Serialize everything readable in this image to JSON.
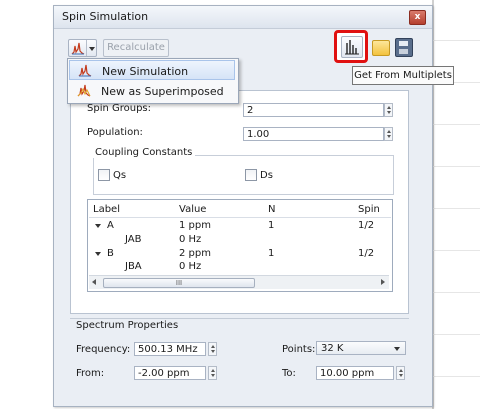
{
  "window": {
    "title": "Spin Simulation",
    "close_symbol": "x"
  },
  "toolbar": {
    "recalculate_label": "Recalculate"
  },
  "menu": {
    "items": [
      {
        "label": "New Simulation"
      },
      {
        "label": "New as Superimposed"
      }
    ]
  },
  "tooltip": {
    "text": "Get From Multiplets"
  },
  "form": {
    "spin_groups_label": "Spin Groups:",
    "spin_groups_value": "2",
    "population_label": "Population:",
    "population_value": "1.00"
  },
  "coupling": {
    "title": "Coupling Constants",
    "qs_label": "Qs",
    "ds_label": "Ds"
  },
  "table": {
    "headers": [
      "Label",
      "Value",
      "N",
      "Spin"
    ],
    "rows": [
      {
        "label": "A",
        "value": "1 ppm",
        "n": "1",
        "spin": "1/2"
      },
      {
        "label": "JAB",
        "value": "0 Hz",
        "n": "",
        "spin": ""
      },
      {
        "label": "B",
        "value": "2 ppm",
        "n": "1",
        "spin": "1/2"
      },
      {
        "label": "JBA",
        "value": "0 Hz",
        "n": "",
        "spin": ""
      }
    ],
    "scroll_grip": "III"
  },
  "spectrum": {
    "title": "Spectrum Properties",
    "frequency_label": "Frequency:",
    "frequency_value": "500.13 MHz",
    "points_label": "Points:",
    "points_value": "32 K",
    "from_label": "From:",
    "from_value": "-2.00 ppm",
    "to_label": "To:",
    "to_value": "10.00 ppm"
  }
}
